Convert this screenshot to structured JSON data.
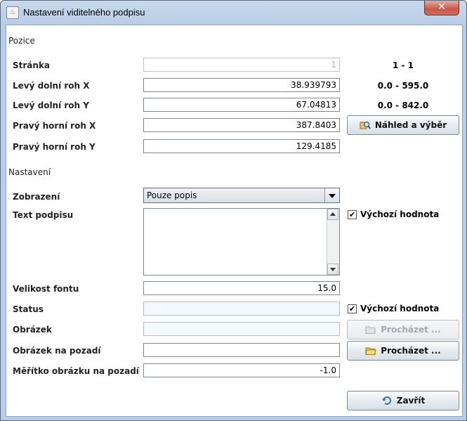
{
  "window": {
    "title": "Nastavení viditelného podpisu",
    "close": "✕"
  },
  "sections": {
    "position": "Pozice",
    "settings": "Nastavení"
  },
  "position": {
    "page": {
      "label": "Stránka",
      "value": "1",
      "range": "1 - 1"
    },
    "lower_left_x": {
      "label": "Levý dolní roh X",
      "value": "38.939793",
      "range": "0.0 - 595.0"
    },
    "lower_left_y": {
      "label": "Levý dolní roh Y",
      "value": "67.04813",
      "range": "0.0 - 842.0"
    },
    "upper_right_x": {
      "label": "Pravý horní roh X",
      "value": "387.8403"
    },
    "upper_right_y": {
      "label": "Pravý horní roh Y",
      "value": "129.4185"
    },
    "preview_button": "Náhled a výběr"
  },
  "settings": {
    "display": {
      "label": "Zobrazení",
      "value": "Pouze popis"
    },
    "signature_text": {
      "label": "Text podpisu",
      "value": "",
      "default_label": "Výchozí hodnota",
      "default_checked": true
    },
    "font_size": {
      "label": "Velikost fontu",
      "value": "15.0"
    },
    "status": {
      "label": "Status",
      "value": "",
      "default_label": "Výchozí hodnota",
      "default_checked": true
    },
    "image": {
      "label": "Obrázek",
      "value": "",
      "browse": "Procházet ..."
    },
    "background_image": {
      "label": "Obrázek na pozadí",
      "value": "",
      "browse": "Procházet ..."
    },
    "background_scale": {
      "label": "Měřítko obrázku na pozadí",
      "value": "-1.0"
    }
  },
  "close_button": "Zavřít",
  "checkmark": "✔"
}
